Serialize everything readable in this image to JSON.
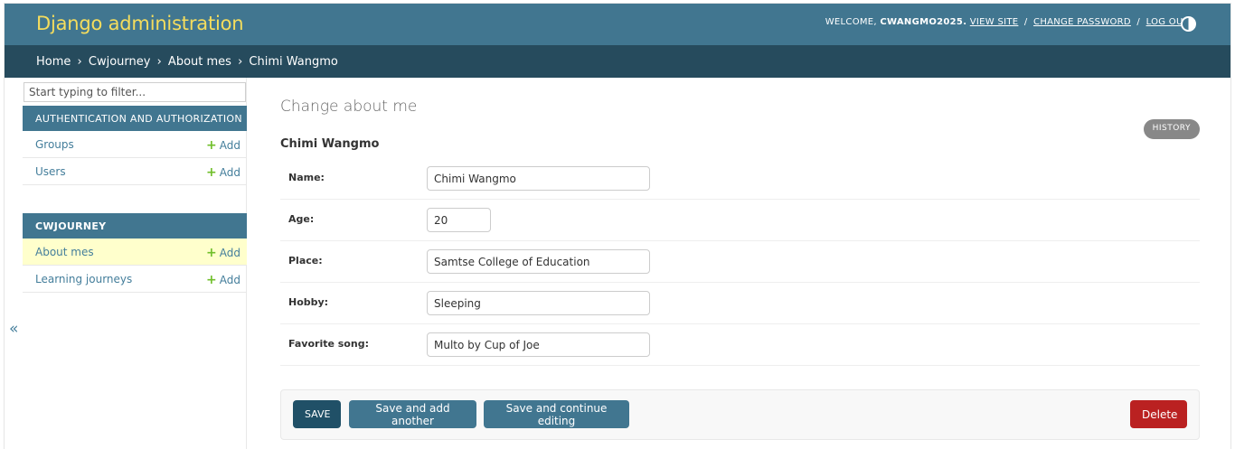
{
  "header": {
    "site_title": "Django administration",
    "welcome": "WELCOME,",
    "username": "CWANGMO2025.",
    "view_site": "VIEW SITE",
    "change_password": "CHANGE PASSWORD",
    "log_out": "LOG OUT",
    "separator": "/",
    "theme_icon": "theme-toggle-icon"
  },
  "breadcrumbs": {
    "items": [
      "Home",
      "Cwjourney",
      "About mes",
      "Chimi Wangmo"
    ],
    "separator": "›"
  },
  "sidebar": {
    "filter_placeholder": "Start typing to filter...",
    "add_label": "Add",
    "modules": [
      {
        "caption": "AUTHENTICATION AND AUTHORIZATION",
        "models": [
          {
            "name": "Groups"
          },
          {
            "name": "Users"
          }
        ]
      },
      {
        "caption": "CWJOURNEY",
        "models": [
          {
            "name": "About mes",
            "current": true
          },
          {
            "name": "Learning journeys"
          }
        ]
      }
    ],
    "collapse_glyph": "«"
  },
  "main": {
    "title": "Change about me",
    "history": "HISTORY",
    "object_name": "Chimi Wangmo",
    "fields": [
      {
        "label": "Name:",
        "value": "Chimi Wangmo"
      },
      {
        "label": "Age:",
        "value": "20"
      },
      {
        "label": "Place:",
        "value": "Samtse College of Education"
      },
      {
        "label": "Hobby:",
        "value": "Sleeping"
      },
      {
        "label": "Favorite song:",
        "value": "Multo by Cup of Joe"
      }
    ],
    "buttons": {
      "save": "SAVE",
      "save_add_another": "Save and add another",
      "save_continue": "Save and continue editing",
      "delete": "Delete"
    }
  },
  "colors": {
    "header_bg": "#417690",
    "breadcrumb_bg": "#264b5d",
    "brand_text": "#f5dd5d",
    "link": "#447e9b",
    "add_plus": "#70bf2b",
    "current_row": "#ffffcc",
    "save_button": "#205067",
    "delete_button": "#ba2121"
  }
}
